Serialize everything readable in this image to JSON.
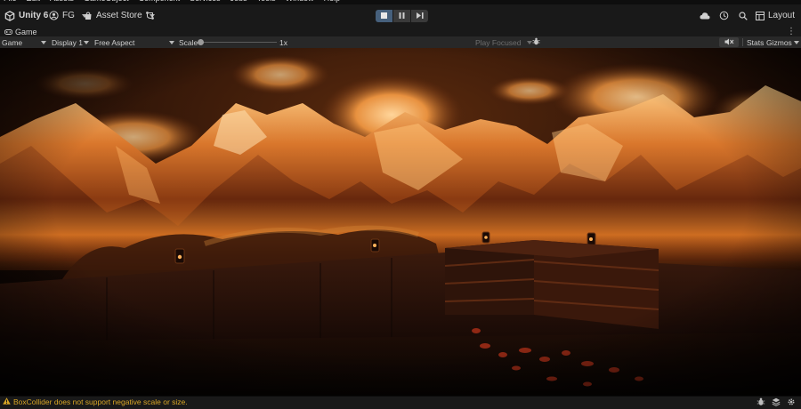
{
  "menu": {
    "items": [
      "File",
      "Edit",
      "Assets",
      "GameObject",
      "Component",
      "Services",
      "Jobs",
      "Tools",
      "Window",
      "Help"
    ]
  },
  "toolbar": {
    "unity_version": "Unity 6",
    "account_label": "FG",
    "asset_store_label": "Asset Store",
    "layout_label": "Layout",
    "play_state": "playing"
  },
  "tab": {
    "title": "Game"
  },
  "game_toolbar": {
    "view_mode": "Game",
    "display": "Display 1",
    "aspect": "Free Aspect",
    "scale_label": "Scale",
    "scale_value": "1x",
    "play_focused": "Play Focused",
    "stats_label": "Stats",
    "gizmos_label": "Gizmos"
  },
  "status": {
    "warning_text": "BoxCollider does not support negative scale or size.",
    "warning_color": "#d8a626"
  },
  "icons": {
    "unity_logo": "unity-logo-icon",
    "account": "account-icon",
    "asset_store": "asset-store-icon",
    "source_control": "branch-icon",
    "cloud": "cloud-icon",
    "history": "history-icon",
    "search": "search-icon",
    "layout": "layout-icon"
  }
}
